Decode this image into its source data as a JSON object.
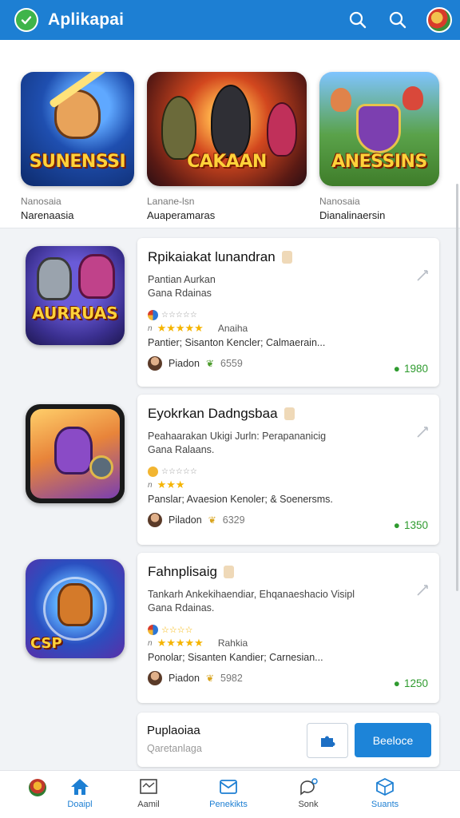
{
  "header": {
    "title": "Aplikapai"
  },
  "featured": [
    {
      "art_label": "SUNENSSI",
      "subtitle": "Nanosaia",
      "name": "Narenaasia"
    },
    {
      "art_label": "CAKAAN",
      "subtitle": "Lanane-lsn",
      "name": "Auaperamaras"
    },
    {
      "art_label": "ANESSINS",
      "subtitle": "Nanosaia",
      "name": "Dianalinaersin"
    }
  ],
  "apps": [
    {
      "art_label": "AURRUAS",
      "title": "Rpikaiakat lunandran",
      "desc_line1": "Pantian Aurkan",
      "desc_line2": "Gana Rdainas",
      "rating_small": "☆☆☆☆☆",
      "rating_stars": "★★★★★",
      "rating_text": "Anaiha",
      "meta": "Pantier; Sisanton Kencler; Calmaerain...",
      "author": "Piadon",
      "count": "6559",
      "price": "1980"
    },
    {
      "art_label": "",
      "title": "Eyokrkan Dadngsbaa",
      "desc_line1": "Peahaarakan Ukigi Jurln: Perapananicig",
      "desc_line2": "Gana Ralaans.",
      "rating_small": "☆☆☆☆☆",
      "rating_stars": "★★★",
      "rating_text": "",
      "meta": "Panslar; Avaesion Kenoler; & Soenersms.",
      "author": "Piladon",
      "count": "6329",
      "price": "1350"
    },
    {
      "art_label": "CSP",
      "title": "Fahnplisaig",
      "desc_line1": "Tankarh Ankekihaendiar, Ehqanaeshacio Visipl",
      "desc_line2": "Gana Rdainas.",
      "rating_small": "☆☆☆☆",
      "rating_stars": "★★★★★",
      "rating_text": "Rahkia",
      "meta": "Ponolar; Sisanten Kandier; Carnesian...",
      "author": "Piadon",
      "count": "5982",
      "price": "1250"
    }
  ],
  "action": {
    "title": "Puplaoiaa",
    "subtitle": "Qaretanlaga",
    "button_label": "Beeloce"
  },
  "nav": [
    {
      "label": "Doaipl",
      "active": true
    },
    {
      "label": "Aamil",
      "active": false
    },
    {
      "label": "Penekikts",
      "active": true
    },
    {
      "label": "Sonk",
      "active": false
    },
    {
      "label": "Suants",
      "active": true
    }
  ],
  "colors": {
    "primary": "#1d7fd3",
    "accent_green": "#2f9b2f",
    "star": "#f5b400"
  }
}
